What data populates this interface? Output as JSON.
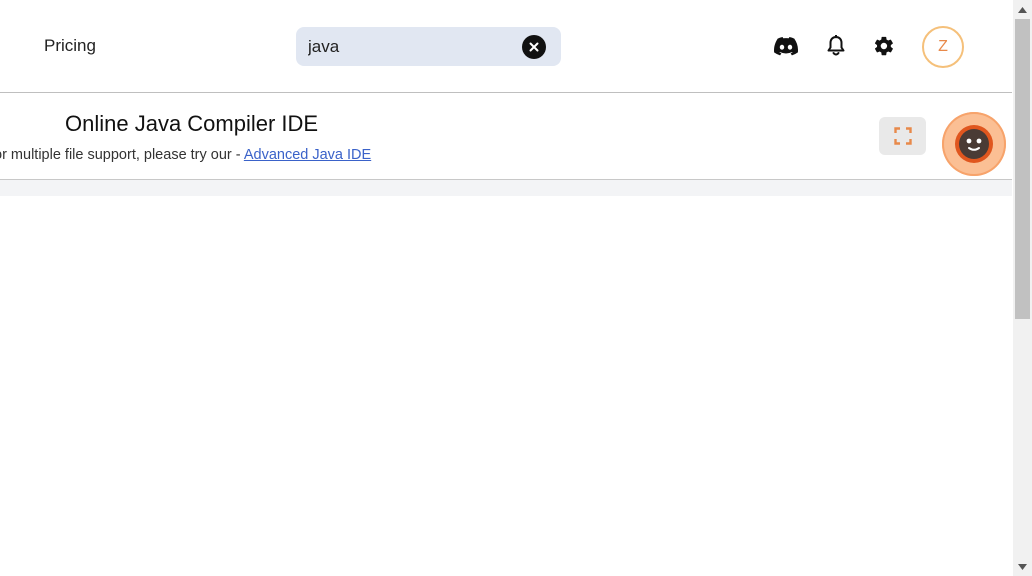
{
  "header": {
    "nav": {
      "pricing_label": "Pricing"
    },
    "search": {
      "value": "java"
    },
    "icons": [
      "discord-icon",
      "bell-icon",
      "gear-icon",
      "close-icon"
    ],
    "avatar": {
      "initial": "Z"
    }
  },
  "main": {
    "title": "Online Java Compiler IDE",
    "subtitle_prefix": "or multiple file support, please try our - ",
    "advanced_link": "Advanced Java IDE"
  },
  "colors": {
    "accent": "#e8894a",
    "search_bg": "#e1e7f2",
    "link": "#3a62c9",
    "avatar_border": "#f5c07a",
    "bot_bg": "#fbbf94"
  }
}
